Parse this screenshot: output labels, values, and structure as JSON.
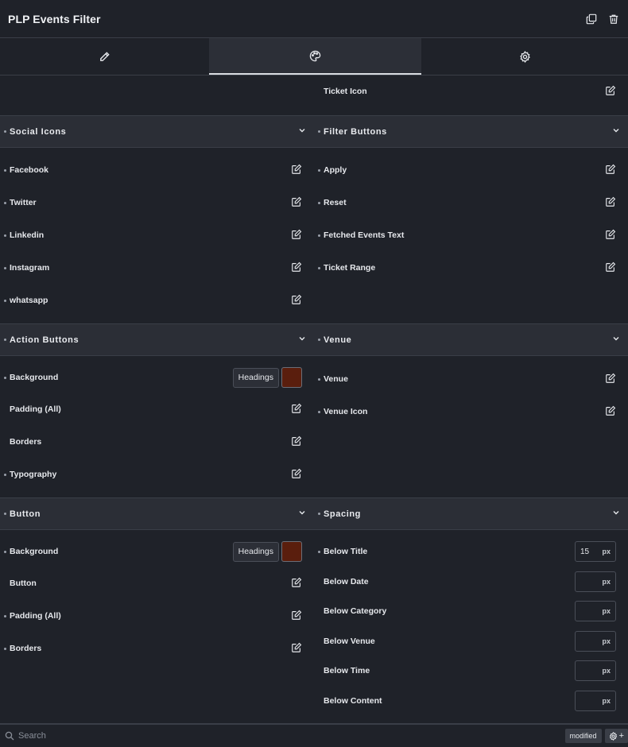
{
  "header": {
    "title": "PLP Events Filter"
  },
  "tabs": [
    {
      "icon": "pencil-icon"
    },
    {
      "icon": "palette-icon"
    },
    {
      "icon": "gear-icon"
    }
  ],
  "right_top": {
    "label": "Ticket Icon"
  },
  "sections": {
    "social_icons": {
      "title": "Social Icons",
      "items": [
        "Facebook",
        "Twitter",
        "Linkedin",
        "Instagram",
        "whatsapp"
      ]
    },
    "filter_buttons": {
      "title": "Filter Buttons",
      "items": [
        "Apply",
        "Reset",
        "Fetched Events Text",
        "Ticket Range"
      ]
    },
    "action_buttons": {
      "title": "Action Buttons",
      "background_label": "Background",
      "headings_label": "Headings",
      "items": [
        "Padding (All)",
        "Borders",
        "Typography"
      ]
    },
    "venue": {
      "title": "Venue",
      "items": [
        "Venue",
        "Venue Icon"
      ]
    },
    "button": {
      "title": "Button",
      "background_label": "Background",
      "headings_label": "Headings",
      "items": [
        "Button",
        "Padding (All)",
        "Borders"
      ]
    },
    "spacing": {
      "title": "Spacing",
      "unit": "px",
      "items": [
        {
          "label": "Below Title",
          "value": "15"
        },
        {
          "label": "Below Date",
          "value": ""
        },
        {
          "label": "Below Category",
          "value": ""
        },
        {
          "label": "Below Venue",
          "value": ""
        },
        {
          "label": "Below Time",
          "value": ""
        },
        {
          "label": "Below Content",
          "value": ""
        }
      ]
    }
  },
  "colors": {
    "swatch": "#5a1e0d",
    "accent": "#2b2e36"
  },
  "footer": {
    "search_placeholder": "Search",
    "badge": "modified",
    "add_label": "+"
  }
}
